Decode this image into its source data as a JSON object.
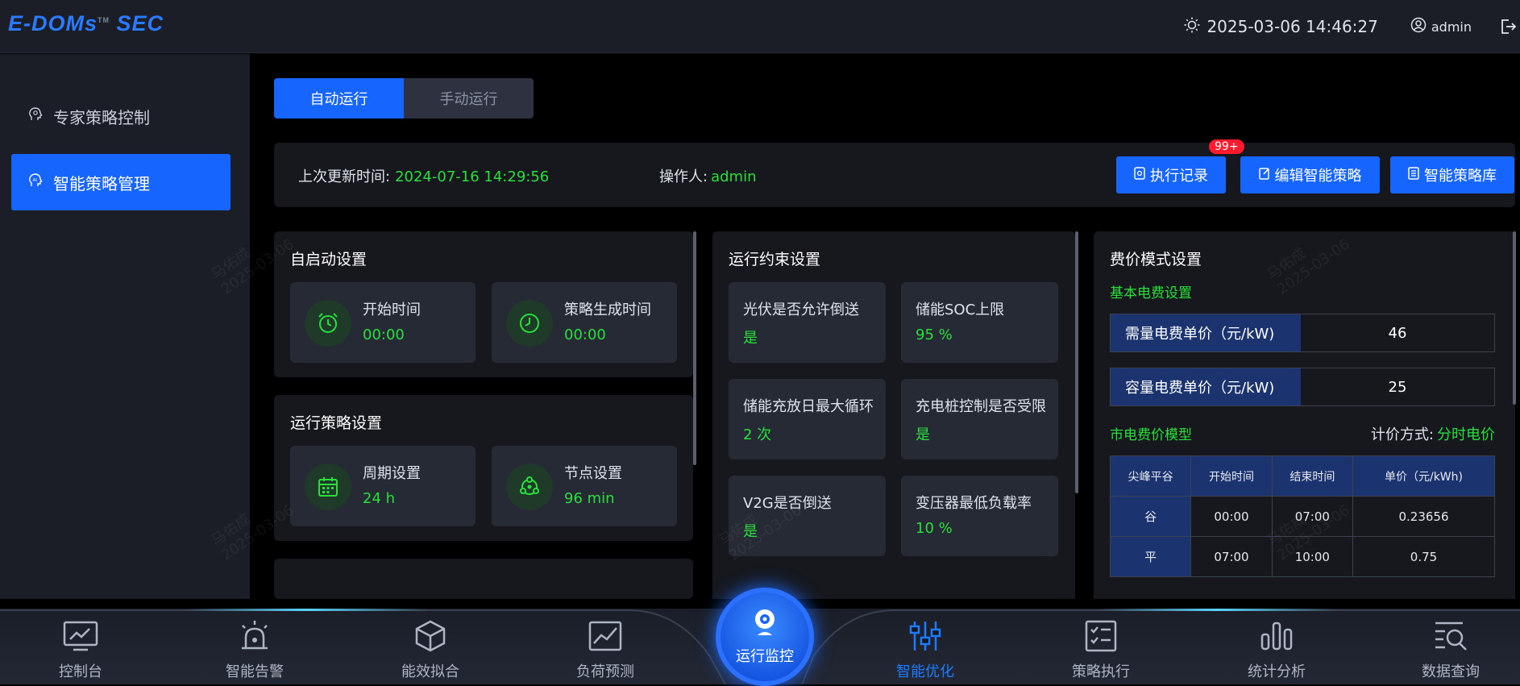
{
  "header": {
    "logo": "E-DOMs",
    "logo_tm": "TM",
    "logo_suffix": "SEC",
    "datetime": "2025-03-06 14:46:27",
    "user": "admin"
  },
  "sidebar": {
    "items": [
      {
        "label": "专家策略控制",
        "icon": "expert-head-icon"
      },
      {
        "label": "智能策略管理",
        "icon": "ai-head-icon"
      }
    ]
  },
  "tabs": [
    {
      "label": "自动运行"
    },
    {
      "label": "手动运行"
    }
  ],
  "infobar": {
    "updated_label": "上次更新时间:",
    "updated_value": "2024-07-16 14:29:56",
    "operator_label": "操作人:",
    "operator_value": "admin",
    "buttons": {
      "records": "执行记录",
      "records_badge": "99+",
      "edit": "编辑智能策略",
      "library": "智能策略库"
    }
  },
  "autostart": {
    "title": "自启动设置",
    "cards": [
      {
        "label": "开始时间",
        "value": "00:00",
        "icon": "alarm-clock-icon"
      },
      {
        "label": "策略生成时间",
        "value": "00:00",
        "icon": "clock-icon"
      }
    ]
  },
  "strategy": {
    "title": "运行策略设置",
    "cards": [
      {
        "label": "周期设置",
        "value": "24 h",
        "icon": "calendar-icon"
      },
      {
        "label": "节点设置",
        "value": "96 min",
        "icon": "nodes-icon"
      }
    ]
  },
  "constraints": {
    "title": "运行约束设置",
    "cards": [
      {
        "label": "光伏是否允许倒送",
        "value": "是"
      },
      {
        "label": "储能SOC上限",
        "value": "95  %"
      },
      {
        "label": "储能充放日最大循环",
        "value": "2  次"
      },
      {
        "label": "充电桩控制是否受限",
        "value": "是"
      },
      {
        "label": "V2G是否倒送",
        "value": "是"
      },
      {
        "label": "变压器最低负载率",
        "value": "10  %"
      }
    ]
  },
  "fee": {
    "title": "费价模式设置",
    "basic_title": "基本电费设置",
    "rows": [
      {
        "key": "需量电费单价（元/kW)",
        "value": "46"
      },
      {
        "key": "容量电费单价（元/kW)",
        "value": "25"
      }
    ],
    "market_title": "市电费价模型",
    "pricing_label": "计价方式:",
    "pricing_value": "分时电价",
    "table": {
      "headers": [
        "尖峰平谷",
        "开始时间",
        "结束时间",
        "单价（元/kWh)"
      ],
      "rows": [
        [
          "谷",
          "00:00",
          "07:00",
          "0.23656"
        ],
        [
          "平",
          "07:00",
          "10:00",
          "0.75"
        ]
      ]
    }
  },
  "bottom_nav": {
    "items": [
      {
        "label": "控制台"
      },
      {
        "label": "智能告警"
      },
      {
        "label": "能效拟合"
      },
      {
        "label": "负荷预测"
      },
      {
        "label": "运行监控"
      },
      {
        "label": "智能优化"
      },
      {
        "label": "策略执行"
      },
      {
        "label": "统计分析"
      },
      {
        "label": "数据查询"
      }
    ]
  },
  "colors": {
    "accent": "#1765ff",
    "value_green": "#27e03a",
    "badge_red": "#ff1b2d",
    "table_header": "#1b3470"
  }
}
